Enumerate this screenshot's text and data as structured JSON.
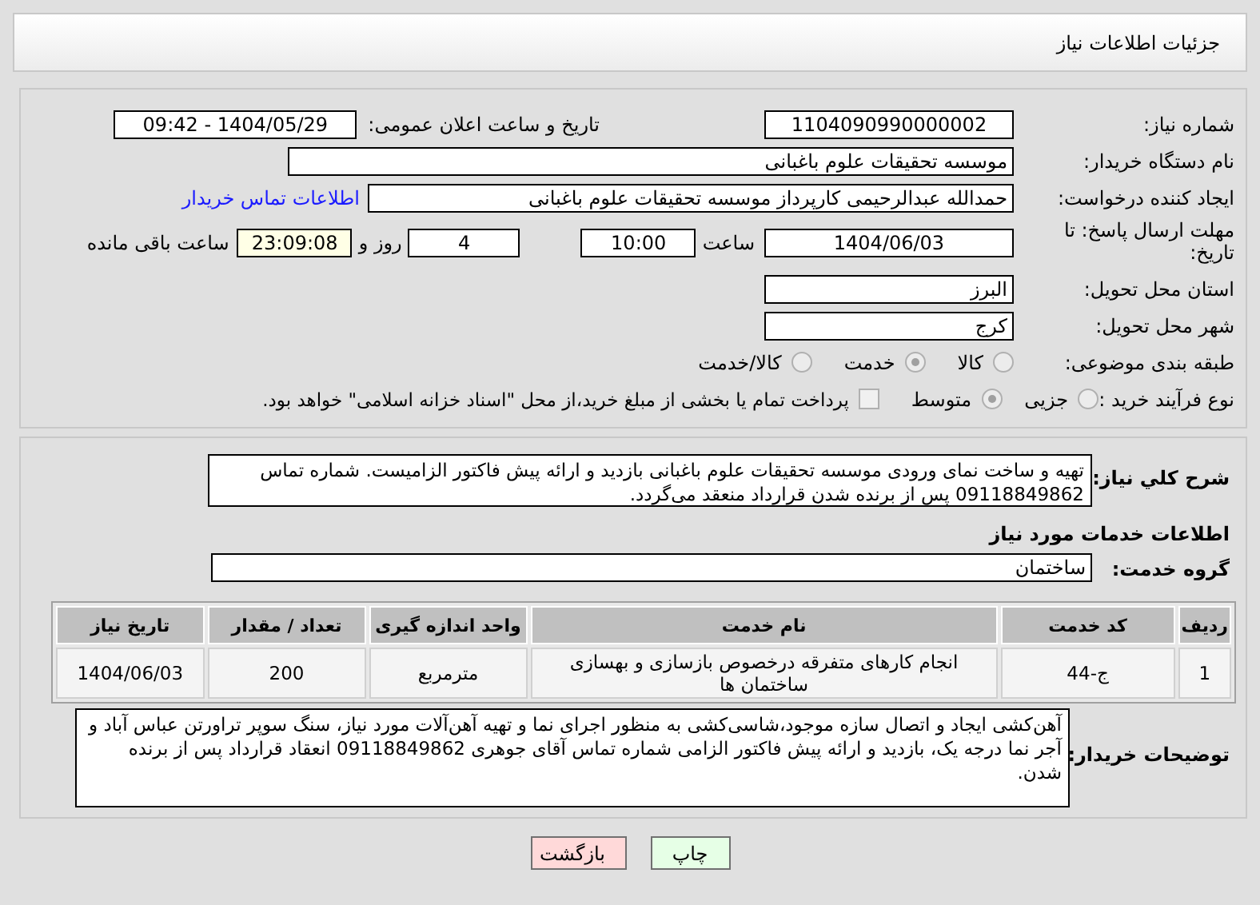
{
  "header": {
    "title": "جزئیات اطلاعات نیاز"
  },
  "need_number": {
    "label": "شماره نیاز:",
    "value": "1104090990000002"
  },
  "announce": {
    "label": "تاریخ و ساعت اعلان عمومی:",
    "value": "1404/05/29 - 09:42"
  },
  "buyer_org": {
    "label": "نام دستگاه خریدار:",
    "value": "موسسه تحقیقات علوم باغبانی"
  },
  "requester": {
    "label": "ایجاد کننده درخواست:",
    "value": "حمدالله عبدالرحیمی کارپرداز موسسه تحقیقات علوم باغبانی",
    "link": "اطلاعات تماس خریدار"
  },
  "deadline": {
    "label": "مهلت ارسال پاسخ: تا تاریخ:",
    "date": "1404/06/03",
    "time_label": "ساعت",
    "time": "10:00",
    "days": "4",
    "days_label": "روز و",
    "remaining": "23:09:08",
    "remaining_label": "ساعت باقی مانده"
  },
  "province": {
    "label": "استان محل تحویل:",
    "value": "البرز"
  },
  "city": {
    "label": "شهر محل تحویل:",
    "value": "کرج"
  },
  "category": {
    "label": "طبقه بندی موضوعی:",
    "options": [
      {
        "label": "کالا",
        "selected": false
      },
      {
        "label": "خدمت",
        "selected": true
      },
      {
        "label": "کالا/خدمت",
        "selected": false
      }
    ]
  },
  "process": {
    "label": "نوع فرآیند خرید :",
    "options": [
      {
        "label": "جزیی",
        "selected": false
      },
      {
        "label": "متوسط",
        "selected": true
      }
    ],
    "treasury": {
      "label": "پرداخت تمام یا بخشی از مبلغ خرید،از محل \"اسناد خزانه اسلامی\" خواهد بود.",
      "checked": false
    }
  },
  "summary": {
    "label": "شرح کلي نياز:",
    "value": "تهیه و ساخت  نمای ورودی موسسه تحقیقات علوم باغبانی بازدید و ارائه پیش فاکتور الزامیست. شماره تماس 09118849862 پس از برنده شدن قرارداد منعقد می‌گردد."
  },
  "services_title": "اطلاعات خدمات مورد نیاز",
  "service_group": {
    "label": "گروه خدمت:",
    "value": "ساختمان"
  },
  "table": {
    "columns": [
      "ردیف",
      "کد خدمت",
      "نام خدمت",
      "واحد اندازه گیری",
      "تعداد / مقدار",
      "تاریخ نیاز"
    ],
    "rows": [
      [
        "1",
        "ج-44",
        "انجام کارهای متفرقه درخصوص بازسازی و بهسازی ساختمان ها",
        "مترمربع",
        "200",
        "1404/06/03"
      ]
    ]
  },
  "buyer_notes": {
    "label": "توضیحات خریدار:",
    "value": "آهن‌کشی ایجاد و اتصال سازه موجود،شاسی‌کشی به منظور اجرای نما و تهیه آهن‌آلات مورد نیاز، سنگ سوپر تراورتن عباس آباد و آجر نما درجه یک، بازدید و ارائه پیش فاکتور الزامی شماره تماس آقای جوهری 09118849862 انعقاد قرارداد پس از برنده شدن."
  },
  "buttons": [
    {
      "label": "چاپ",
      "kind": "print"
    },
    {
      "label": "بازگشت",
      "kind": "back"
    }
  ]
}
